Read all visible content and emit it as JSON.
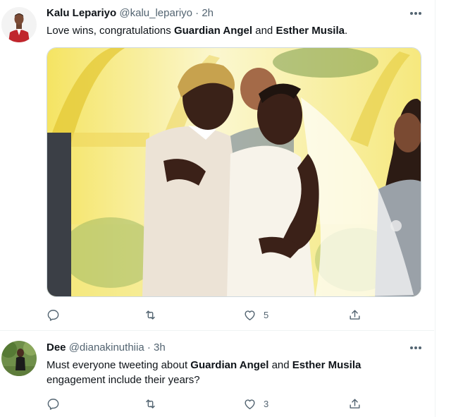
{
  "tweets": [
    {
      "name": "Kalu Lepariyo",
      "handle": "@kalu_lepariyo",
      "separator": "·",
      "time": "2h",
      "text": {
        "part1": "Love wins, congratulations ",
        "bold1": "Guardian Angel",
        "part2": " and ",
        "bold2": "Esther Musila",
        "part3": "."
      },
      "likes": "5",
      "avatar": "man-in-red-suit-avatar",
      "photo": "wedding-kiss-photo"
    },
    {
      "name": "Dee",
      "handle": "@dianakinuthiia",
      "separator": "·",
      "time": "3h",
      "text": {
        "part1": "Must everyone tweeting about ",
        "bold1": "Guardian Angel",
        "part2": " and ",
        "bold2": "Esther Musila",
        "part3": " engagement include their years?"
      },
      "likes": "3",
      "avatar": "woman-outdoors-avatar"
    }
  ],
  "icons": {
    "more": "more-icon",
    "reply": "reply-icon",
    "retweet": "retweet-icon",
    "like": "like-icon",
    "share": "share-icon"
  },
  "colors": {
    "text": "#0f1419",
    "secondary": "#536471",
    "border": "#eff3f4"
  }
}
